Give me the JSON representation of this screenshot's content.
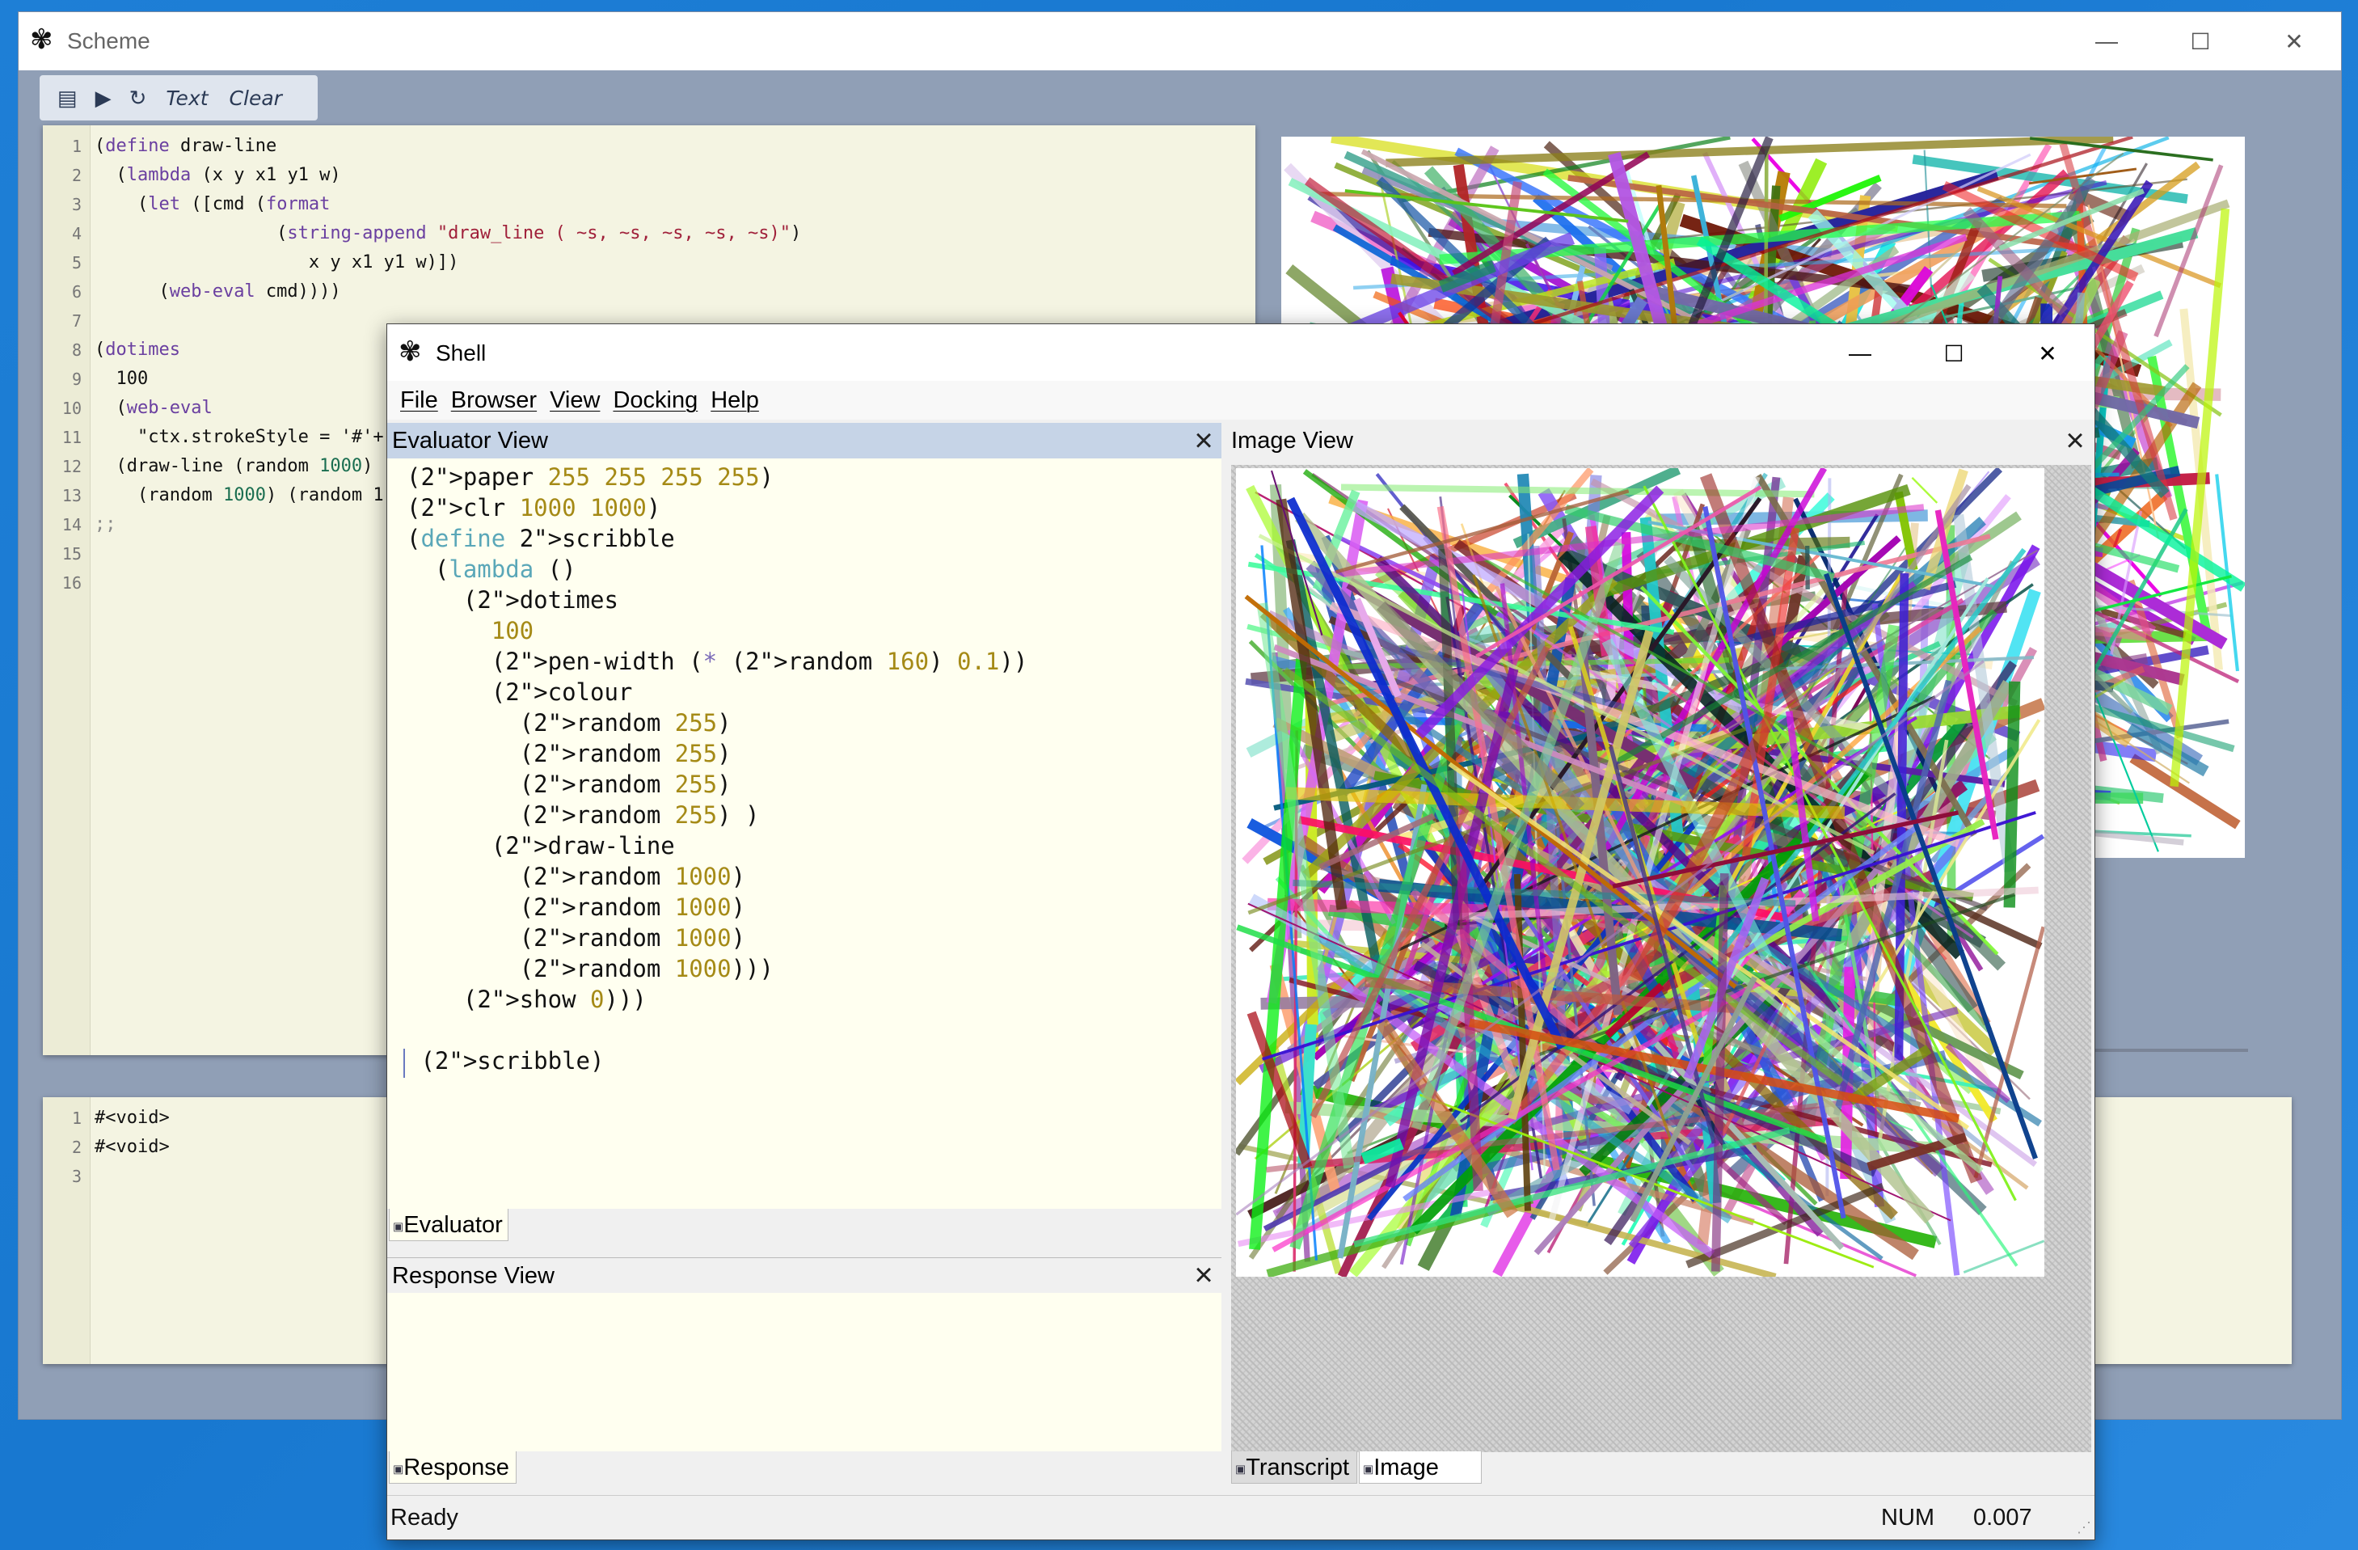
{
  "scheme_window": {
    "title": "Scheme",
    "toolbar": {
      "text_label": "Text",
      "clear_label": "Clear"
    },
    "editor_lines": [
      "(define draw-line",
      "  (lambda (x y x1 y1 w)",
      "    (let ([cmd (format",
      "                 (string-append \"draw_line ( ~s, ~s, ~s, ~s, ~s)\")",
      "                    x y x1 y1 w)])",
      "      (web-eval cmd))))",
      "",
      "(dotimes",
      "  100",
      "  (web-eval",
      "    \"ctx.strokeStyle = '#'+",
      "  (draw-line (random 1000)",
      "    (random 1000) (random 1",
      ";;",
      "",
      ""
    ],
    "output_lines": [
      "#<void>",
      "#<void>",
      ""
    ]
  },
  "shell_window": {
    "title": "Shell",
    "menu": [
      "File",
      "Browser",
      "View",
      "Docking",
      "Help"
    ],
    "evaluator_view": {
      "title": "Evaluator View",
      "tab": "Evaluator",
      "lines": [
        "(paper 255 255 255 255)",
        "(clr 1000 1000)",
        "(define scribble",
        "  (lambda ()",
        "    (dotimes",
        "      100",
        "      (pen-width (* (random 160) 0.1))",
        "      (colour",
        "        (random 255)",
        "        (random 255)",
        "        (random 255)",
        "        (random 255) )",
        "      (draw-line",
        "        (random 1000)",
        "        (random 1000)",
        "        (random 1000)",
        "        (random 1000)))",
        "    (show 0)))",
        "",
        " (scribble)"
      ]
    },
    "response_view": {
      "title": "Response View",
      "tab": "Response"
    },
    "image_view": {
      "title": "Image View",
      "tabs": [
        "Transcript",
        "Image"
      ]
    },
    "status": {
      "ready": "Ready",
      "num": "NUM",
      "time": "0.007"
    }
  },
  "icons": [
    "scheme-logo-icon",
    "book-icon",
    "play-icon",
    "refresh-icon",
    "minimize-icon",
    "maximize-icon",
    "close-icon"
  ],
  "colors": {
    "desktop": "#1e7fd6",
    "editor_bg": "#f4f4e2",
    "evaluator_bg": "#fffff0",
    "scheme_bg": "#909fb6"
  }
}
